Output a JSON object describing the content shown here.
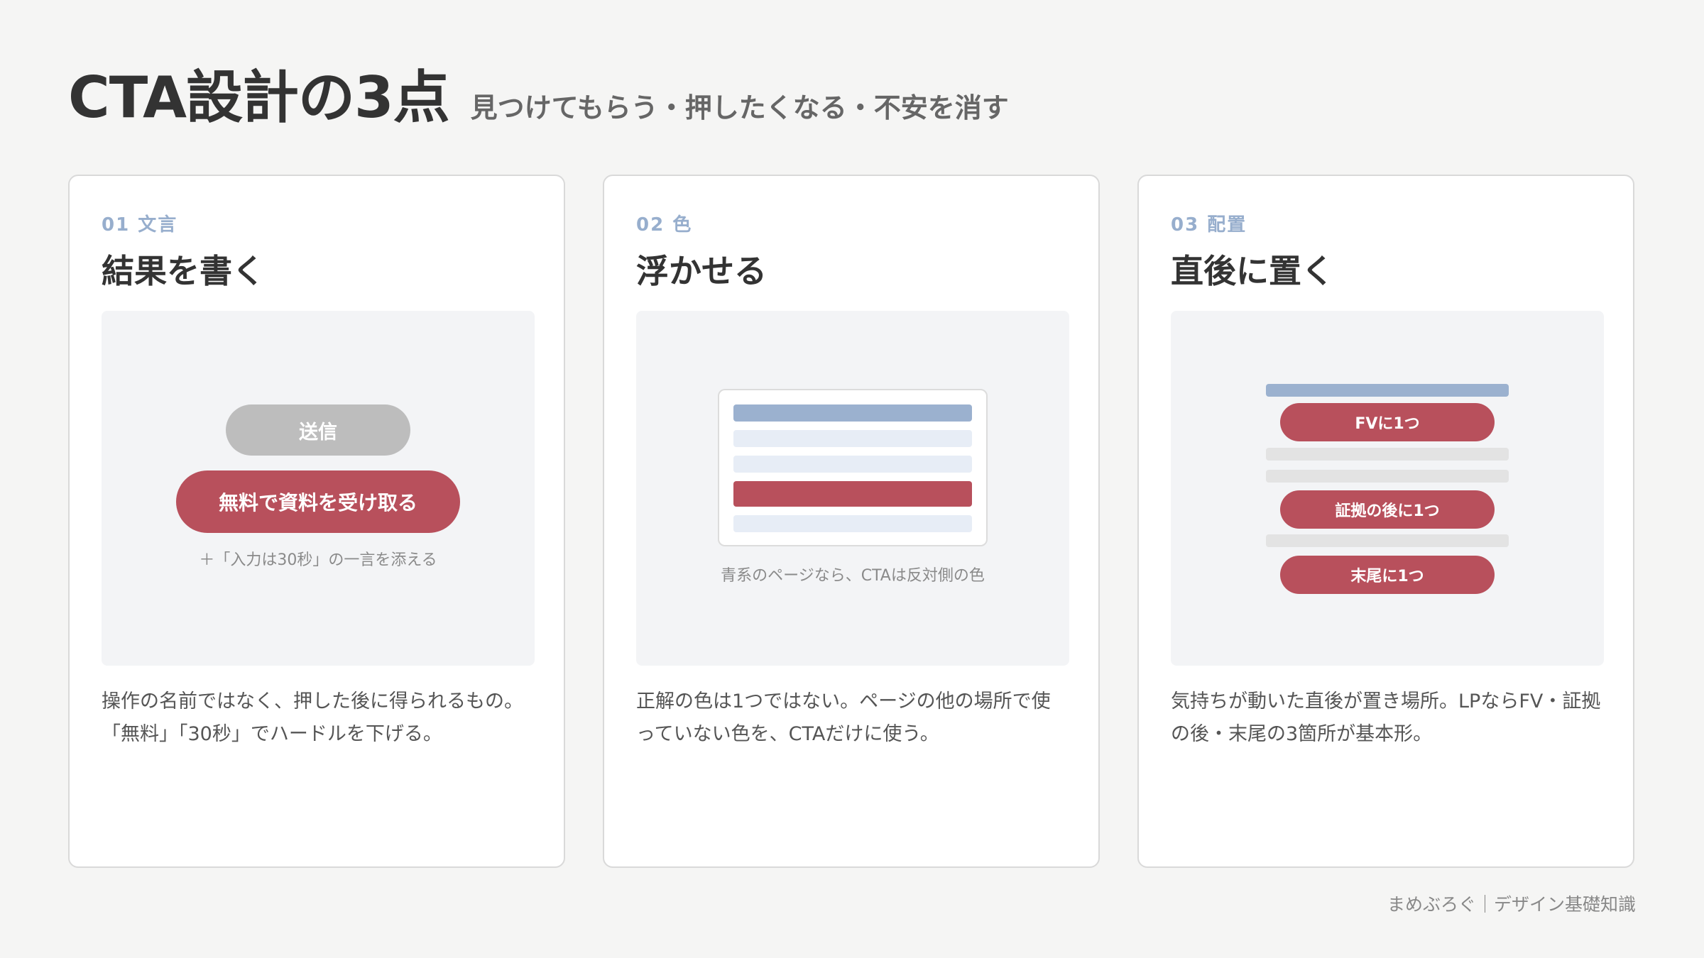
{
  "header": {
    "title": "CTA設計の3点",
    "subtitle": "見つけてもらう・押したくなる・不安を消す"
  },
  "cards": [
    {
      "number": "01 文言",
      "title": "結果を書く",
      "illustration": {
        "gray_button": "送信",
        "red_button": "無料で資料を受け取る",
        "note": "＋「入力は30秒」の一言を添える"
      },
      "description": "操作の名前ではなく、押した後に得られるもの。「無料」「30秒」でハードルを下げる。"
    },
    {
      "number": "02 色",
      "title": "浮かせる",
      "illustration": {
        "note": "青系のページなら、CTAは反対側の色"
      },
      "description": "正解の色は1つではない。ページの他の場所で使っていない色を、CTAだけに使う。"
    },
    {
      "number": "03 配置",
      "title": "直後に置く",
      "illustration": {
        "pill_1": "FVに1つ",
        "pill_2": "証拠の後に1つ",
        "pill_3": "末尾に1つ"
      },
      "description": "気持ちが動いた直後が置き場所。LPならFV・証拠の後・末尾の3箇所が基本形。"
    }
  ],
  "footer": {
    "credit": "まめぶろぐ｜デザイン基礎知識"
  },
  "colors": {
    "accent_red": "#b8505c",
    "accent_blue": "#9bb1cf",
    "label_blue": "#97aecd",
    "neutral_gray": "#bdbdbd"
  }
}
